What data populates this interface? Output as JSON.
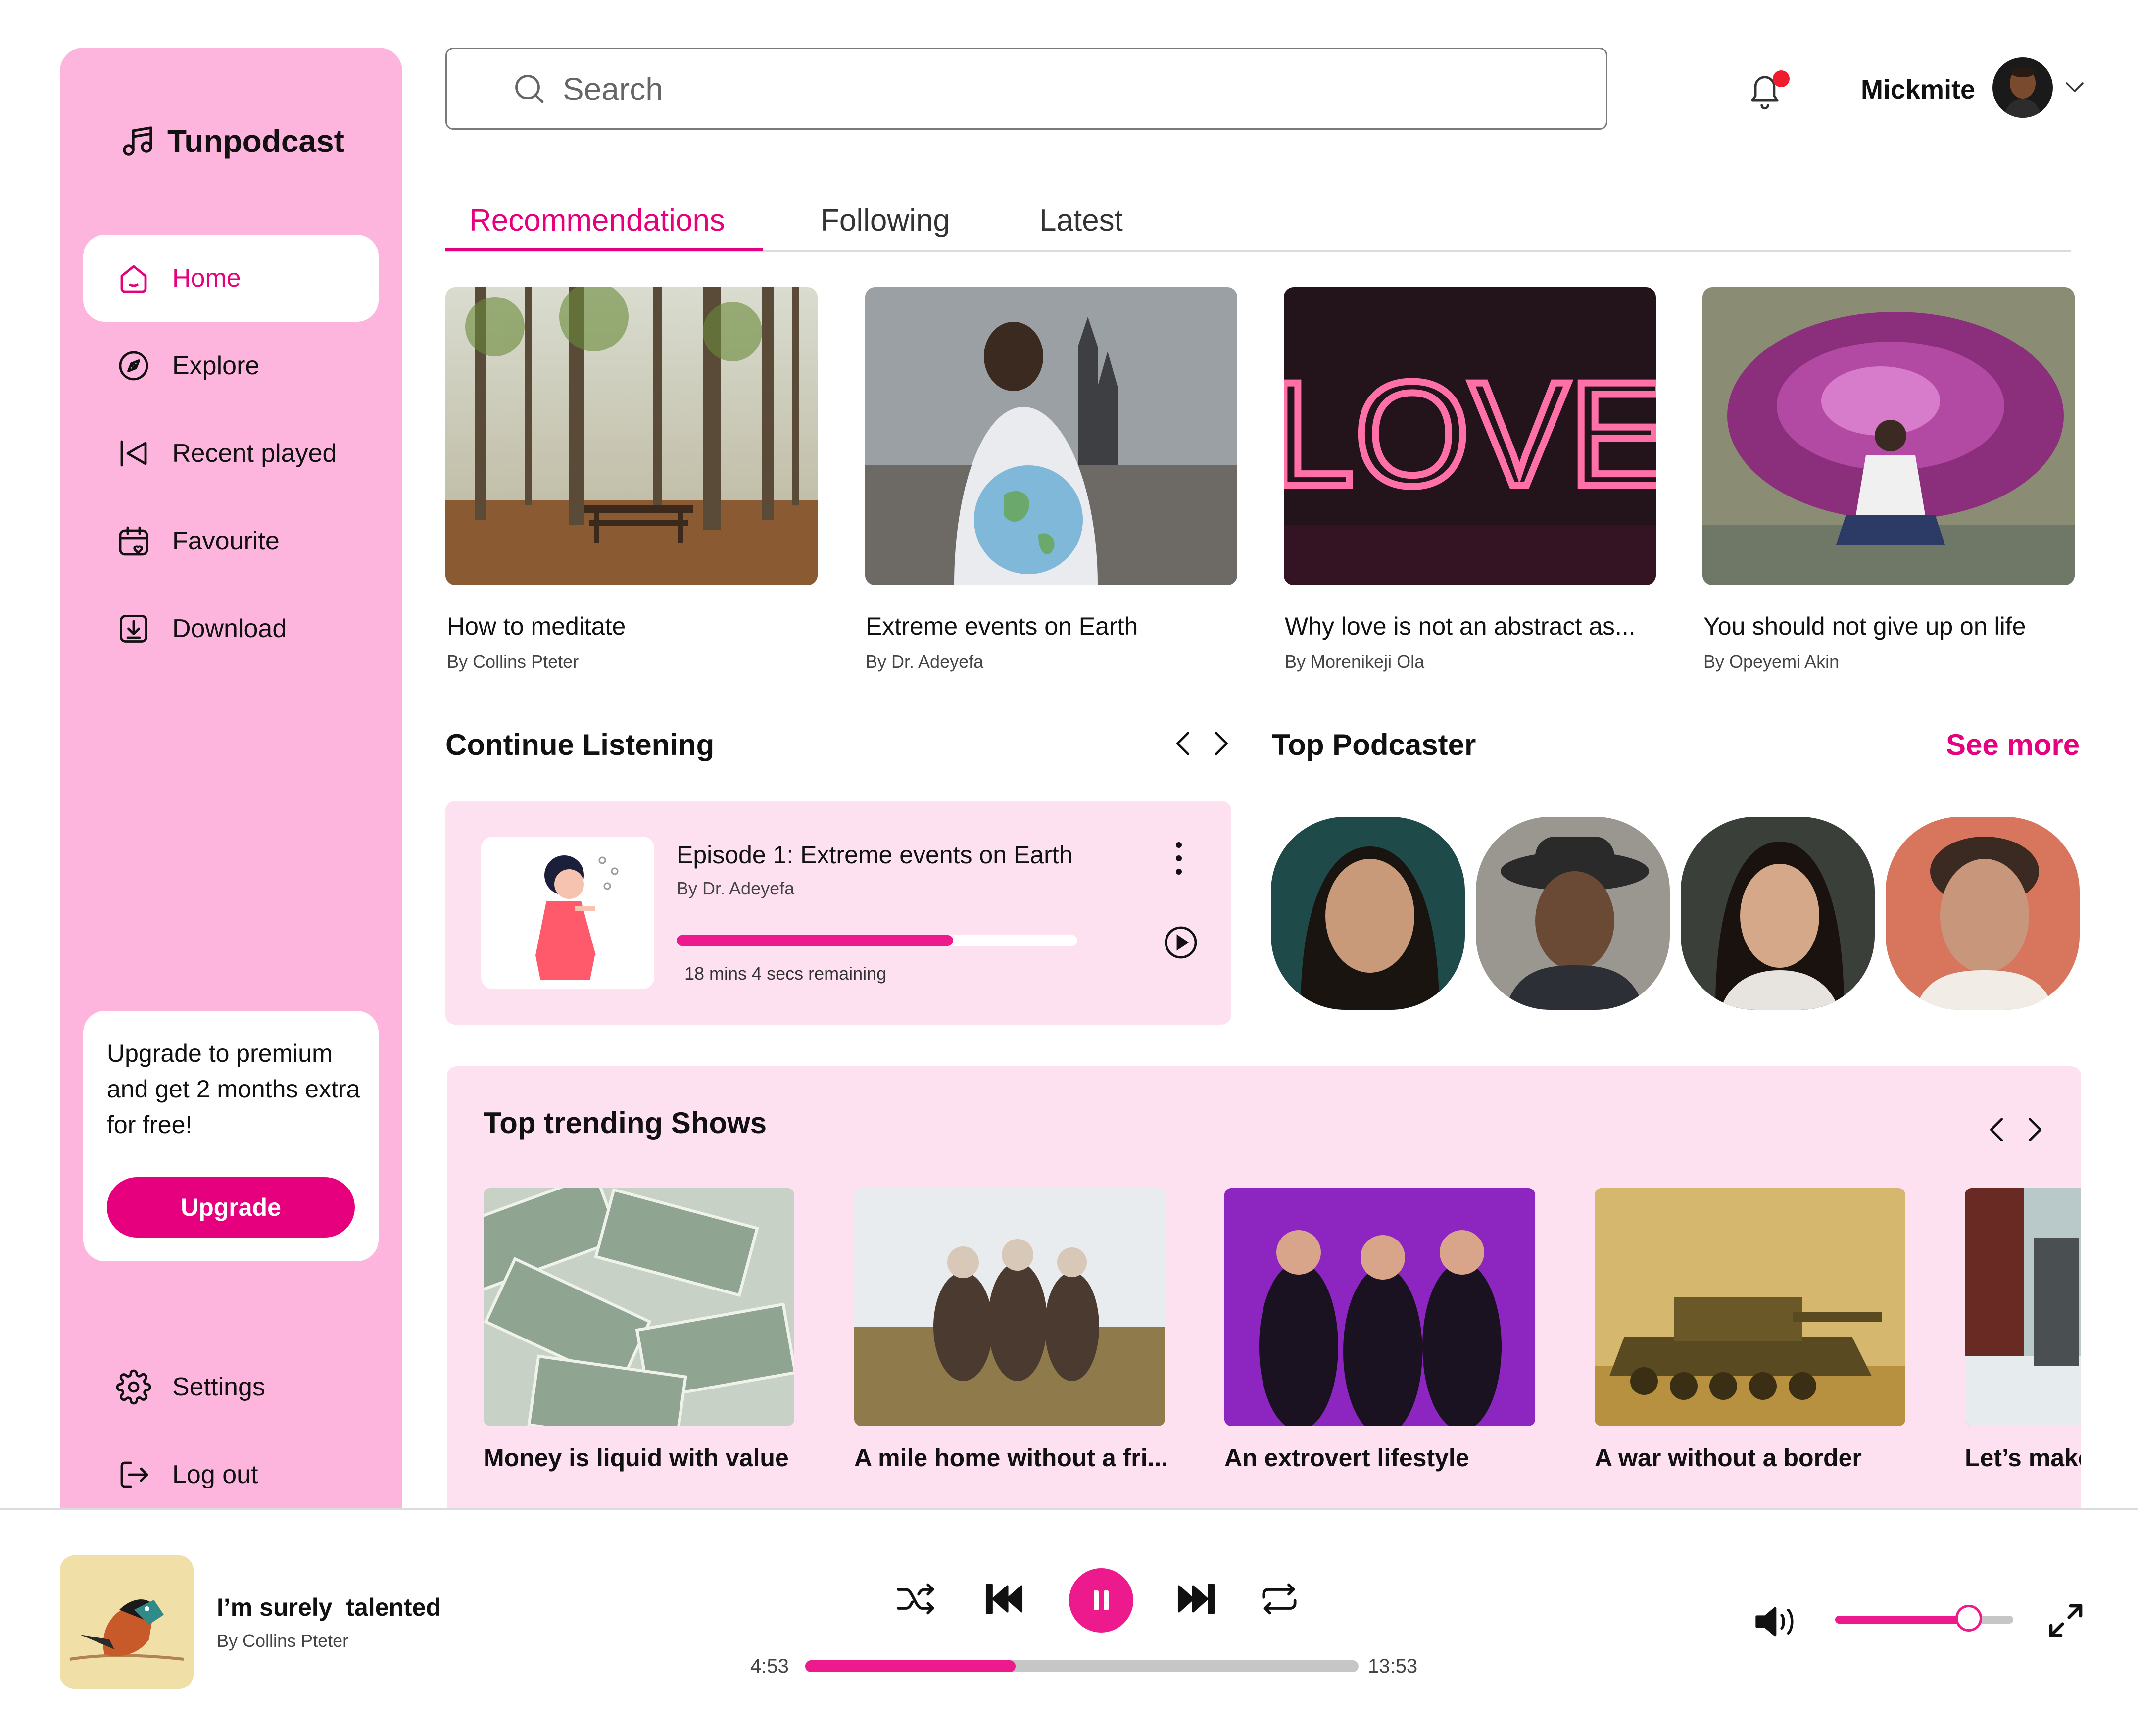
{
  "app": {
    "name": "Tunpodcast",
    "accent": "#e6007e",
    "sidebar_bg": "#fdb4dd",
    "panel_bg": "#fde1f1"
  },
  "sidebar": {
    "items": [
      {
        "label": "Home",
        "icon": "home-icon",
        "active": true
      },
      {
        "label": "Explore",
        "icon": "compass-icon"
      },
      {
        "label": "Recent played",
        "icon": "recent-icon"
      },
      {
        "label": "Favourite",
        "icon": "favourite-icon"
      },
      {
        "label": "Download",
        "icon": "download-icon"
      }
    ],
    "upgrade": {
      "text": "Upgrade to premium and get 2 months extra for free!",
      "button": "Upgrade"
    },
    "footer": [
      {
        "label": "Settings",
        "icon": "gear-icon"
      },
      {
        "label": "Log out",
        "icon": "logout-icon"
      }
    ]
  },
  "header": {
    "search_placeholder": "Search",
    "user_name": "Mickmite",
    "notification_dot": true
  },
  "tabs": [
    {
      "label": "Recommendations",
      "active": true
    },
    {
      "label": "Following"
    },
    {
      "label": "Latest"
    }
  ],
  "recommendations": [
    {
      "title": "How to meditate",
      "author": "By Collins Pteter"
    },
    {
      "title": "Extreme events on Earth",
      "author": "By Dr. Adeyefa"
    },
    {
      "title": "Why love is not an abstract as...",
      "author": "By Morenikeji Ola",
      "image_text": "LOVE"
    },
    {
      "title": "You should not give up on life",
      "author": "By Opeyemi Akin"
    }
  ],
  "continue_listening": {
    "title": "Continue Listening",
    "episode_title": "Episode 1: Extreme events on Earth",
    "author": "By Dr. Adeyefa",
    "progress": 0.69,
    "remaining": "18 mins 4 secs remaining"
  },
  "top_podcaster": {
    "title": "Top Podcaster",
    "see_more": "See more"
  },
  "trending": {
    "title": "Top trending Shows",
    "items": [
      {
        "title": "Money is liquid with value"
      },
      {
        "title": "A mile home without a fri..."
      },
      {
        "title": "An extrovert lifestyle"
      },
      {
        "title": "A war without a border"
      },
      {
        "title": "Let’s make"
      }
    ]
  },
  "player": {
    "title": "I’m surely  talented",
    "author": "By Collins Pteter",
    "current_time": "4:53",
    "total_time": "13:53",
    "progress": 0.38,
    "volume": 0.75
  }
}
